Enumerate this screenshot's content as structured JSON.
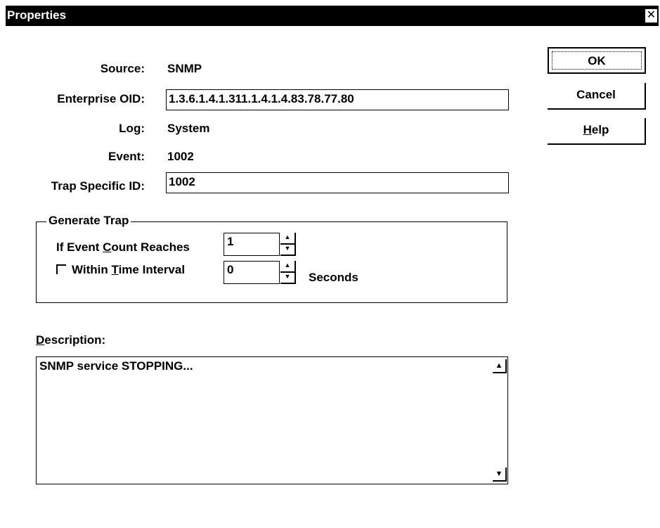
{
  "window": {
    "title": "Properties",
    "close_glyph": "✕"
  },
  "fields": {
    "source_label": "Source:",
    "source_value": "SNMP",
    "enterprise_oid_label": "Enterprise OID:",
    "enterprise_oid_value": "1.3.6.1.4.1.311.1.4.1.4.83.78.77.80",
    "log_label": "Log:",
    "log_value": "System",
    "event_label": "Event:",
    "event_value": "1002",
    "trap_specific_id_label": "Trap Specific ID:",
    "trap_specific_id_value": "1002"
  },
  "buttons": {
    "ok": "OK",
    "cancel": "Cancel",
    "help_pre": "",
    "help_ul": "H",
    "help_post": "elp"
  },
  "generate_trap": {
    "legend": "Generate Trap",
    "count_label_pre": "If Event ",
    "count_label_ul": "C",
    "count_label_post": "ount Reaches",
    "count_value": "1",
    "interval_label_pre": "Within ",
    "interval_label_ul": "T",
    "interval_label_post": "ime Interval",
    "interval_checked": false,
    "interval_value": "0",
    "seconds_label": "Seconds"
  },
  "description": {
    "label_ul": "D",
    "label_post": "escription:",
    "text": "SNMP service STOPPING..."
  },
  "icons": {
    "spin_up": "▲",
    "spin_down": "▼",
    "scroll_up": "▲",
    "scroll_down": "▼"
  }
}
